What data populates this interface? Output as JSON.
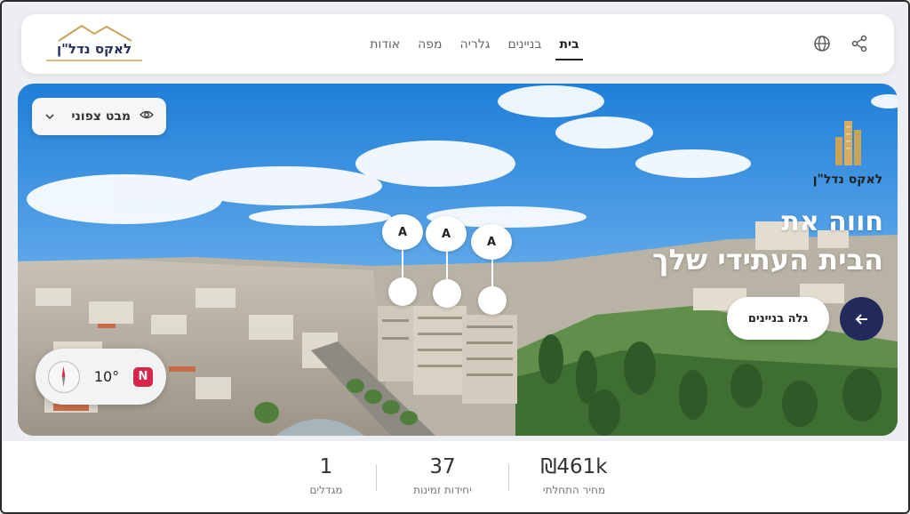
{
  "brand": {
    "name": "לאקס נדל\"ן"
  },
  "nav": {
    "items": [
      {
        "label": "בית",
        "active": true
      },
      {
        "label": "בניינים",
        "active": false
      },
      {
        "label": "גלריה",
        "active": false
      },
      {
        "label": "מפה",
        "active": false
      },
      {
        "label": "אודות",
        "active": false
      }
    ],
    "icons": [
      "globe-icon",
      "share-icon"
    ]
  },
  "hero": {
    "view_select": {
      "label": "מבט צפוני",
      "icons": [
        "eye-icon",
        "chevron-down-icon"
      ]
    },
    "headline_line1": "חווה את",
    "headline_line2": "הבית העתידי שלך",
    "cta_label": "גלה בניינים",
    "arrow_icon": "arrow-left-icon",
    "pins": [
      "A",
      "A",
      "A"
    ],
    "compass": {
      "degrees": "10°",
      "badge": "N"
    }
  },
  "stats": [
    {
      "value": "₪461k",
      "label": "מחיר התחלתי"
    },
    {
      "value": "37",
      "label": "יחידות זמינות"
    },
    {
      "value": "1",
      "label": "מגדלים"
    }
  ],
  "colors": {
    "accent": "#222a5c",
    "gold": "#c9a35a",
    "north_badge": "#d7264a"
  }
}
